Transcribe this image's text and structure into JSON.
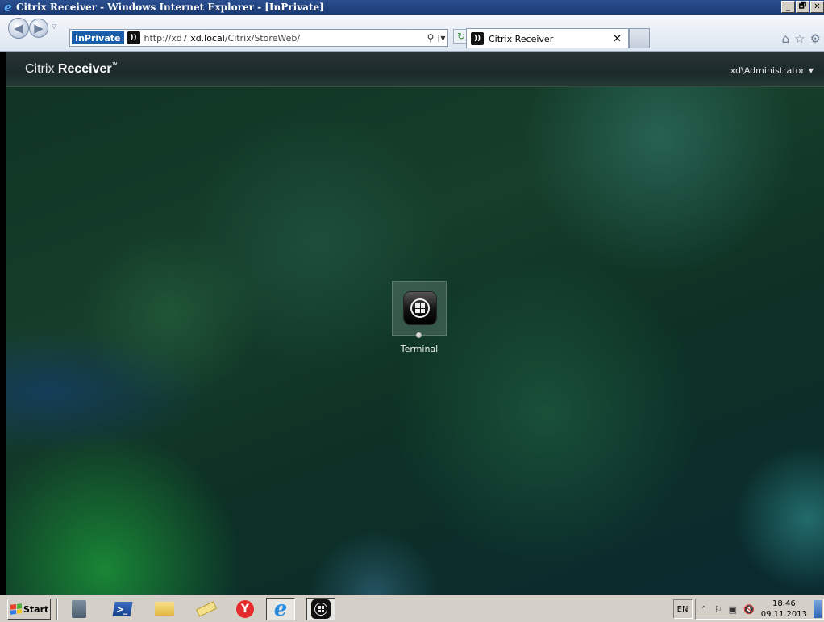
{
  "window": {
    "title": "Citrix Receiver - Windows Internet Explorer - [InPrivate]",
    "controls": [
      "_",
      "🗗",
      "✕"
    ]
  },
  "browser": {
    "inprivate_label": "InPrivate",
    "url_prefix": "http://xd7.",
    "url_domain": "xd.local",
    "url_path": "/Citrix/StoreWeb/",
    "tab_label": "Citrix Receiver",
    "icons": [
      "back-icon",
      "forward-icon",
      "search-icon",
      "refresh-icon",
      "home-icon",
      "favorites-icon",
      "tools-icon"
    ]
  },
  "citrix": {
    "brand_light": "Citrix",
    "brand_bold": "Receiver",
    "user": "xd\\Administrator"
  },
  "apps": [
    {
      "label": "Terminal",
      "icon": "windows-desktop-icon"
    }
  ],
  "taskbar": {
    "start_label": "Start",
    "language": "EN",
    "time": "18:46",
    "date": "09.11.2013",
    "pinned": [
      "server-manager-icon",
      "powershell-icon",
      "explorer-icon",
      "notepad-icon",
      "yandex-icon",
      "internet-explorer-icon",
      "citrix-desktop-icon"
    ]
  }
}
